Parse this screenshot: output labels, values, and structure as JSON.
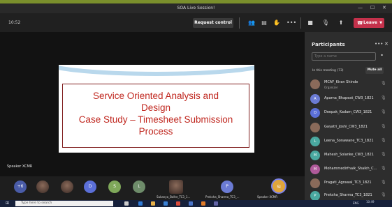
{
  "window": {
    "title": "SOA Live Session!",
    "minimize": "—",
    "maximize": "☐",
    "close": "✕"
  },
  "toolbar": {
    "timer": "10:52",
    "request_control": "Request control",
    "leave": "Leave",
    "icons": [
      "people-icon",
      "chat-icon",
      "raise-hand-icon",
      "more-icon",
      "camera-icon",
      "mic-icon",
      "share-icon"
    ]
  },
  "slide": {
    "line1": "Service Oriented Analysis and",
    "line2": "Design",
    "line3": "Case Study – Timesheet Submission",
    "line4": "Process"
  },
  "stage": {
    "speaker_label": "Speaker XCMR"
  },
  "bottom_tiles": [
    {
      "initials": "+6",
      "color": "#4a5ca8"
    },
    {
      "initials": "",
      "color": "photo"
    },
    {
      "initials": "",
      "color": "photo"
    },
    {
      "initials": "D",
      "color": "#5b6fd8"
    },
    {
      "initials": "S",
      "color": "#7fa85a"
    },
    {
      "initials": "L",
      "color": "#6e8c6a"
    }
  ],
  "named_tiles": [
    {
      "name": "Sukanya_Bolhe_TC3_1..."
    },
    {
      "name": "Prekshа_Sharma_TC3_..."
    },
    {
      "name": "Speaker XCMR",
      "initials": "SI"
    }
  ],
  "panel": {
    "title": "Participants",
    "search_placeholder": "Type a name",
    "meeting_label": "In this meeting (73)",
    "mute_all": "Mute all",
    "participants": [
      {
        "name": "MCAF_Kiran Shinde",
        "role": "Organizer",
        "initials": "",
        "color": "#8a6a5a"
      },
      {
        "name": "Aparna_Bhapeat_CW3_1821",
        "role": "",
        "initials": "A",
        "color": "#6b7bd4"
      },
      {
        "name": "Deepak_Kadam_CW3_1821",
        "role": "",
        "initials": "D",
        "color": "#5b6fd8"
      },
      {
        "name": "Gayatri_Joshi_CW3_1821",
        "role": "",
        "initials": "",
        "color": "#8a6a5a"
      },
      {
        "name": "Leena_Sonawane_TC3_1821",
        "role": "",
        "initials": "L",
        "color": "#4aa8a0"
      },
      {
        "name": "Mahesh_Solanke_CW3_1821",
        "role": "",
        "initials": "M",
        "color": "#4aa8a0"
      },
      {
        "name": "Mohammedirfnaik_Shaikh_C...",
        "role": "",
        "initials": "M",
        "color": "#b05a9a"
      },
      {
        "name": "Pragati_Agrawal_TC3_1821",
        "role": "",
        "initials": "",
        "color": "#8a6a5a"
      },
      {
        "name": "Preksha_Sharma_TC3_1821",
        "role": "",
        "initials": "P",
        "color": "#4aa8a0"
      }
    ]
  },
  "taskbar": {
    "search_placeholder": "Type here to search",
    "time": "10:49",
    "lang": "ENG"
  }
}
